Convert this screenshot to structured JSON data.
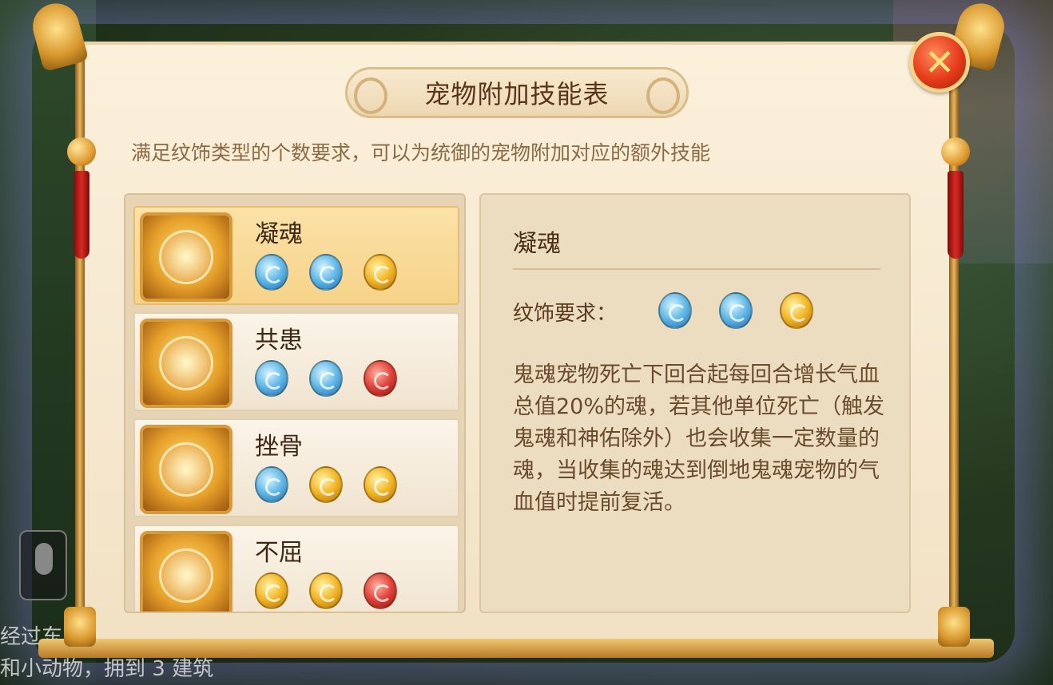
{
  "window": {
    "title": "宠物附加技能表",
    "subtitle": "满足纹饰类型的个数要求，可以为统御的宠物附加对应的额外技能"
  },
  "close_icon": "close-icon",
  "skills": [
    {
      "name": "凝魂",
      "gems": [
        "blue",
        "blue",
        "gold"
      ],
      "selected": true
    },
    {
      "name": "共患",
      "gems": [
        "blue",
        "blue",
        "red"
      ],
      "selected": false
    },
    {
      "name": "挫骨",
      "gems": [
        "blue",
        "gold",
        "gold"
      ],
      "selected": false
    },
    {
      "name": "不屈",
      "gems": [
        "gold",
        "gold",
        "red"
      ],
      "selected": false
    }
  ],
  "detail": {
    "name": "凝魂",
    "requirement_label": "纹饰要求：",
    "requirement_gems": [
      "blue",
      "blue",
      "gold"
    ],
    "description": "鬼魂宠物死亡下回合起每回合增长气血总值20%的魂，若其他单位死亡（触发鬼魂和神佑除外）也会收集一定数量的魂，当收集的魂达到倒地鬼魂宠物的气血值时提前复活。"
  },
  "background": {
    "chat_line_1": "经过东",
    "chat_line_2": "和小动物，拥到 3 建筑"
  },
  "colors": {
    "gem_blue": "#5fb7e6",
    "gem_gold": "#f2b526",
    "gem_red": "#e0423a",
    "selected_row": "#f6d389"
  }
}
